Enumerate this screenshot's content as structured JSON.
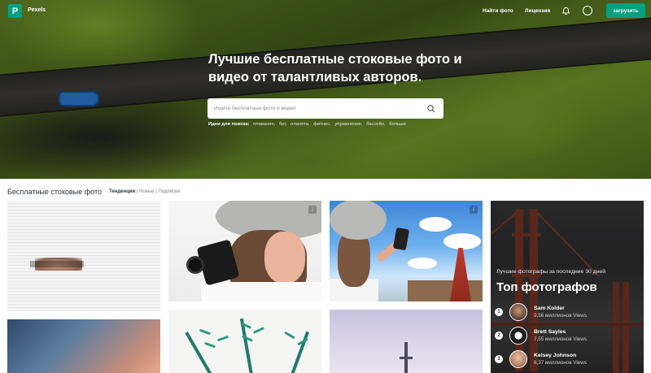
{
  "header": {
    "brand": "Pexels",
    "logo_letter": "P",
    "nav": {
      "find_photos": "Найти фото",
      "license": "Лицензия"
    },
    "upload_label": "загрузить",
    "brand_color": "#05A081"
  },
  "hero": {
    "title": "Лучшие бесплатные стоковые фото и видео от талантливых авторов.",
    "search_placeholder": "Ищите бесплатные фото и видео",
    "ideas_label": "Идеи для поиска:",
    "ideas": [
      "плавание,",
      "бег,",
      "планета,",
      "фитнес,",
      "упражнение,",
      "бассейн,",
      "больше"
    ]
  },
  "main": {
    "section_title": "Бесплатные стоковые фото",
    "tabs": {
      "trending": "Тенденции",
      "sep1": "|",
      "new": "Новые",
      "sep2": "|",
      "subscriptions": "Подписки"
    },
    "download_icon": "download-icon"
  },
  "top_photographers": {
    "subtitle": "Лучшие фотографы за последние 30 дней",
    "title": "Топ фотографов",
    "list": [
      {
        "rank": "1",
        "name": "Sam Kolder",
        "views": "9,56 миллионов Views"
      },
      {
        "rank": "2",
        "name": "Brett Sayles",
        "views": "7,55 миллионов Views"
      },
      {
        "rank": "3",
        "name": "Kelsey Johnson",
        "views": "6,37 миллионов Views"
      }
    ]
  }
}
